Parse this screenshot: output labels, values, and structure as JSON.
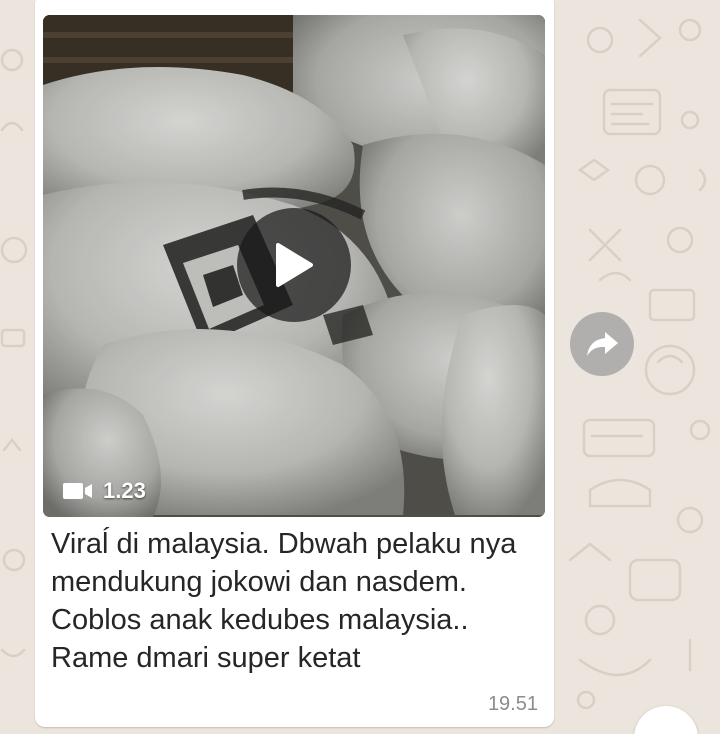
{
  "message": {
    "caption": "Viraĺ di malaysia. Dbwah pelaku nya mendukung jokowi dan nasdem. Coblos anak kedubes malaysia.. Rame dmari super ketat",
    "time": "19.51",
    "video": {
      "duration": "1.23",
      "duration_icon": "video-camera-icon",
      "play_icon": "play-icon"
    }
  },
  "actions": {
    "forward_icon": "forward-icon"
  },
  "colors": {
    "chat_background": "#ece5dd",
    "bubble": "#ffffff",
    "caption_text": "#262626",
    "timestamp": "#8c8c8c"
  }
}
